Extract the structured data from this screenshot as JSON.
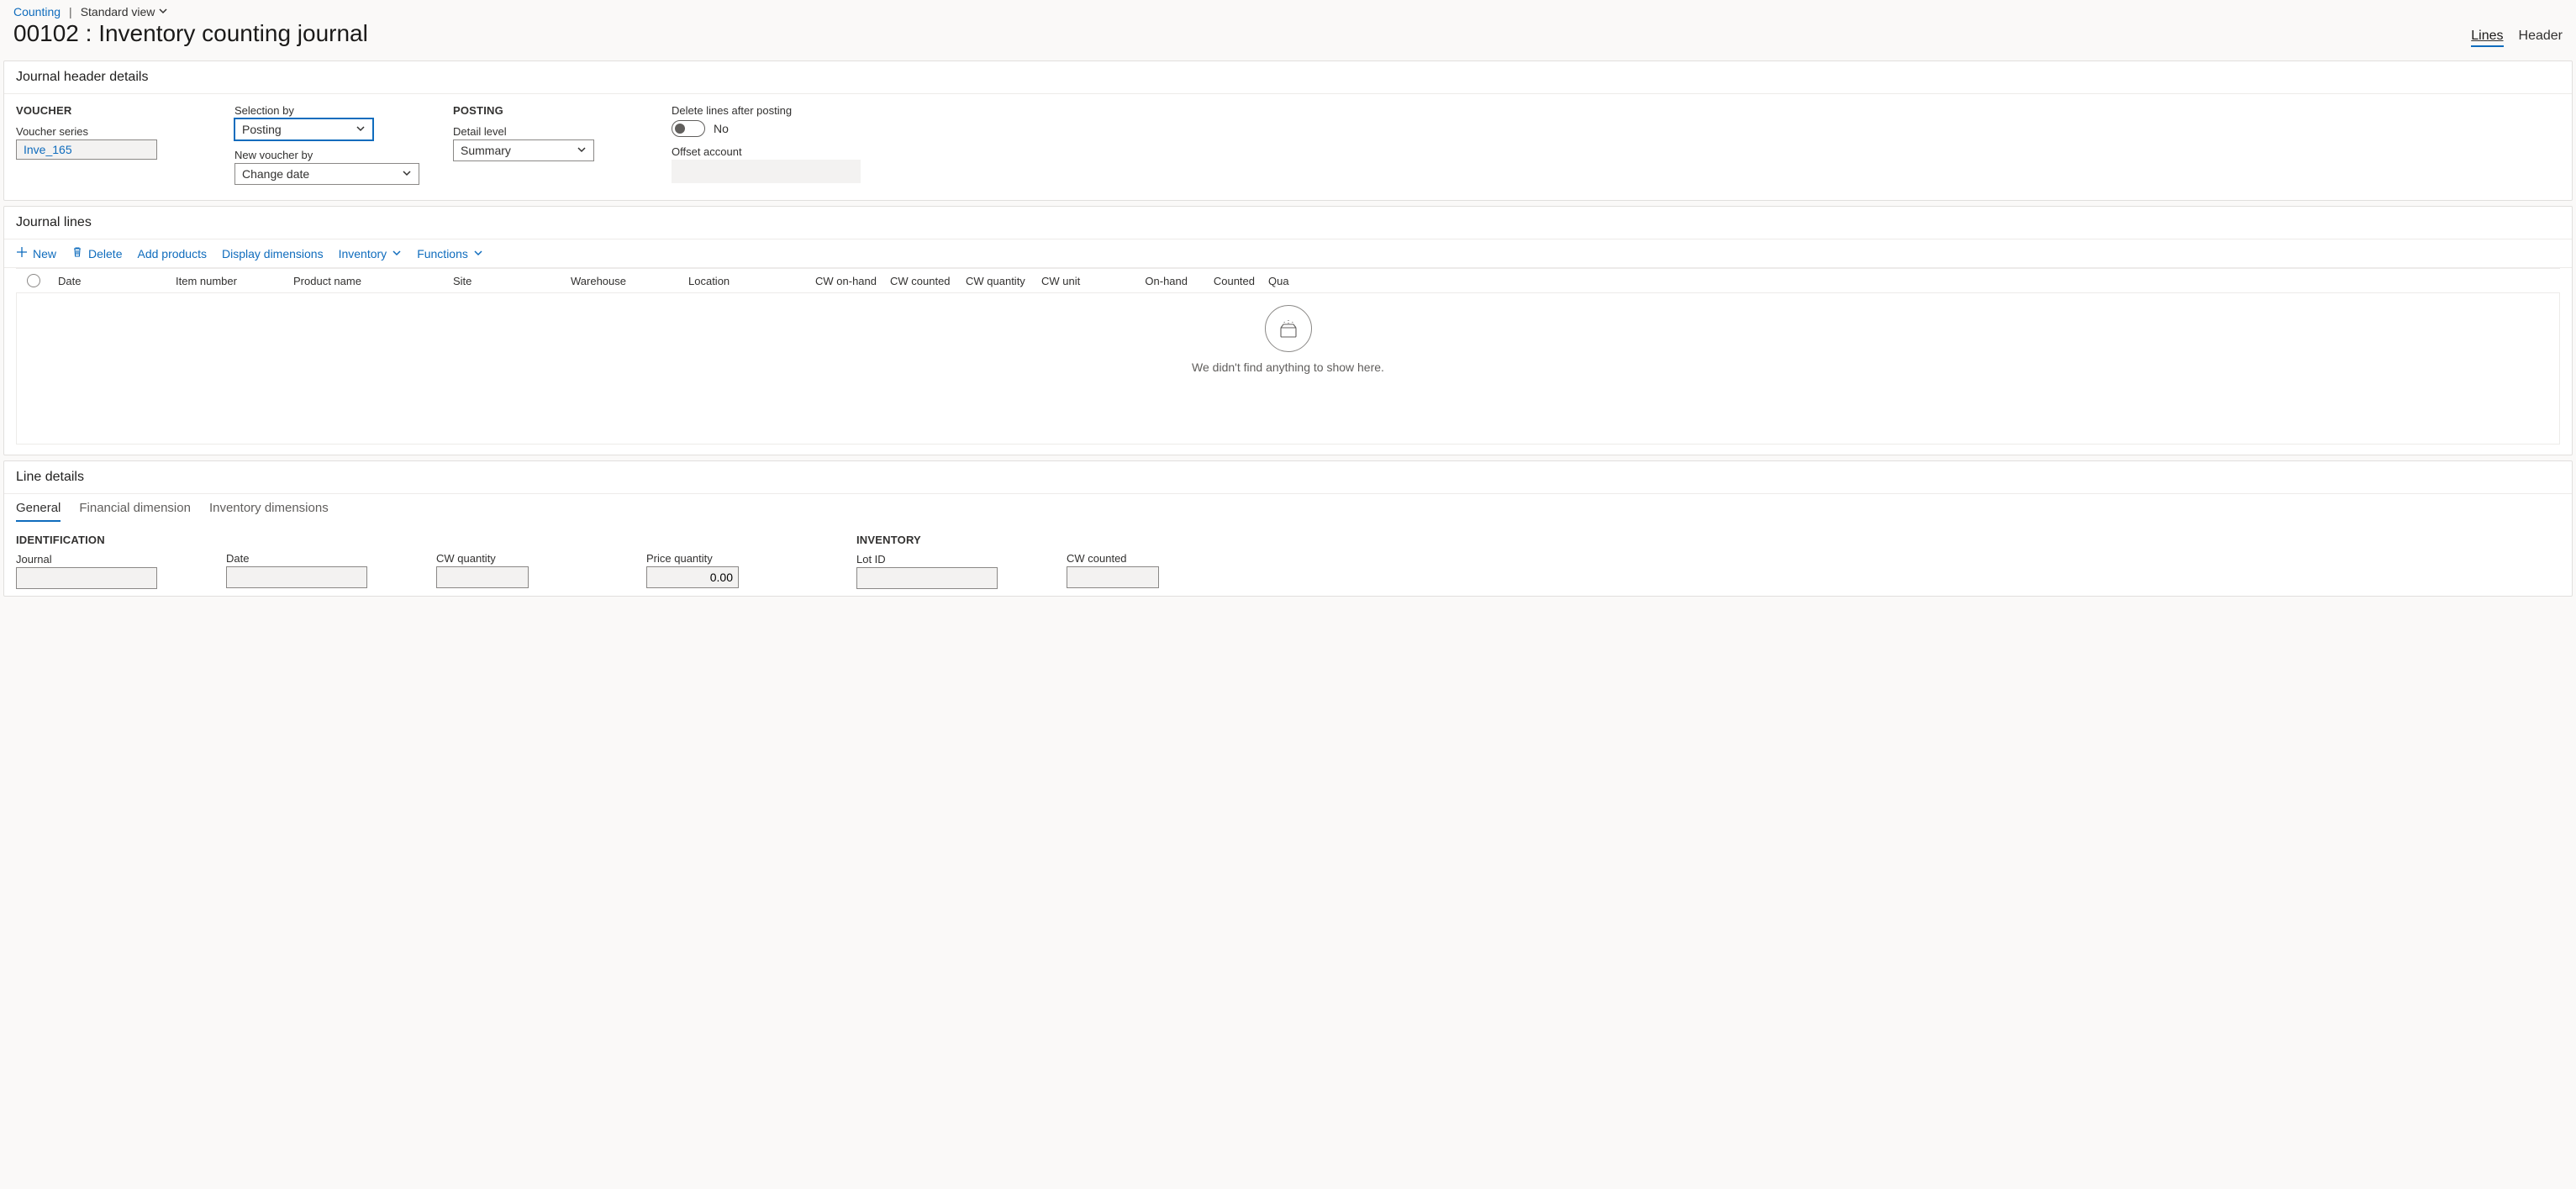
{
  "breadcrumb": {
    "counting": "Counting",
    "view": "Standard view"
  },
  "page_title": "00102 : Inventory counting journal",
  "view_tabs": {
    "lines": "Lines",
    "header": "Header"
  },
  "journal_header": {
    "title": "Journal header details",
    "voucher_heading": "VOUCHER",
    "voucher_series_label": "Voucher series",
    "voucher_series_value": "Inve_165",
    "selection_by_label": "Selection by",
    "selection_by_value": "Posting",
    "new_voucher_by_label": "New voucher by",
    "new_voucher_by_value": "Change date",
    "posting_heading": "POSTING",
    "detail_level_label": "Detail level",
    "detail_level_value": "Summary",
    "delete_lines_label": "Delete lines after posting",
    "delete_lines_value": "No",
    "offset_account_label": "Offset account",
    "offset_account_value": ""
  },
  "journal_lines": {
    "title": "Journal lines",
    "toolbar": {
      "new": "New",
      "delete": "Delete",
      "add_products": "Add products",
      "display_dimensions": "Display dimensions",
      "inventory": "Inventory",
      "functions": "Functions"
    },
    "columns": [
      "Date",
      "Item number",
      "Product name",
      "Site",
      "Warehouse",
      "Location",
      "CW on-hand",
      "CW counted",
      "CW quantity",
      "CW unit",
      "On-hand",
      "Counted",
      "Qua"
    ],
    "empty_message": "We didn't find anything to show here."
  },
  "line_details": {
    "title": "Line details",
    "tabs": {
      "general": "General",
      "financial": "Financial dimension",
      "inventory_dims": "Inventory dimensions"
    },
    "identification_heading": "IDENTIFICATION",
    "journal_label": "Journal",
    "date_label": "Date",
    "cw_qty_label": "CW quantity",
    "price_qty_label": "Price quantity",
    "price_qty_value": "0.00",
    "inventory_heading": "INVENTORY",
    "lot_id_label": "Lot ID",
    "cw_counted_label": "CW counted"
  }
}
